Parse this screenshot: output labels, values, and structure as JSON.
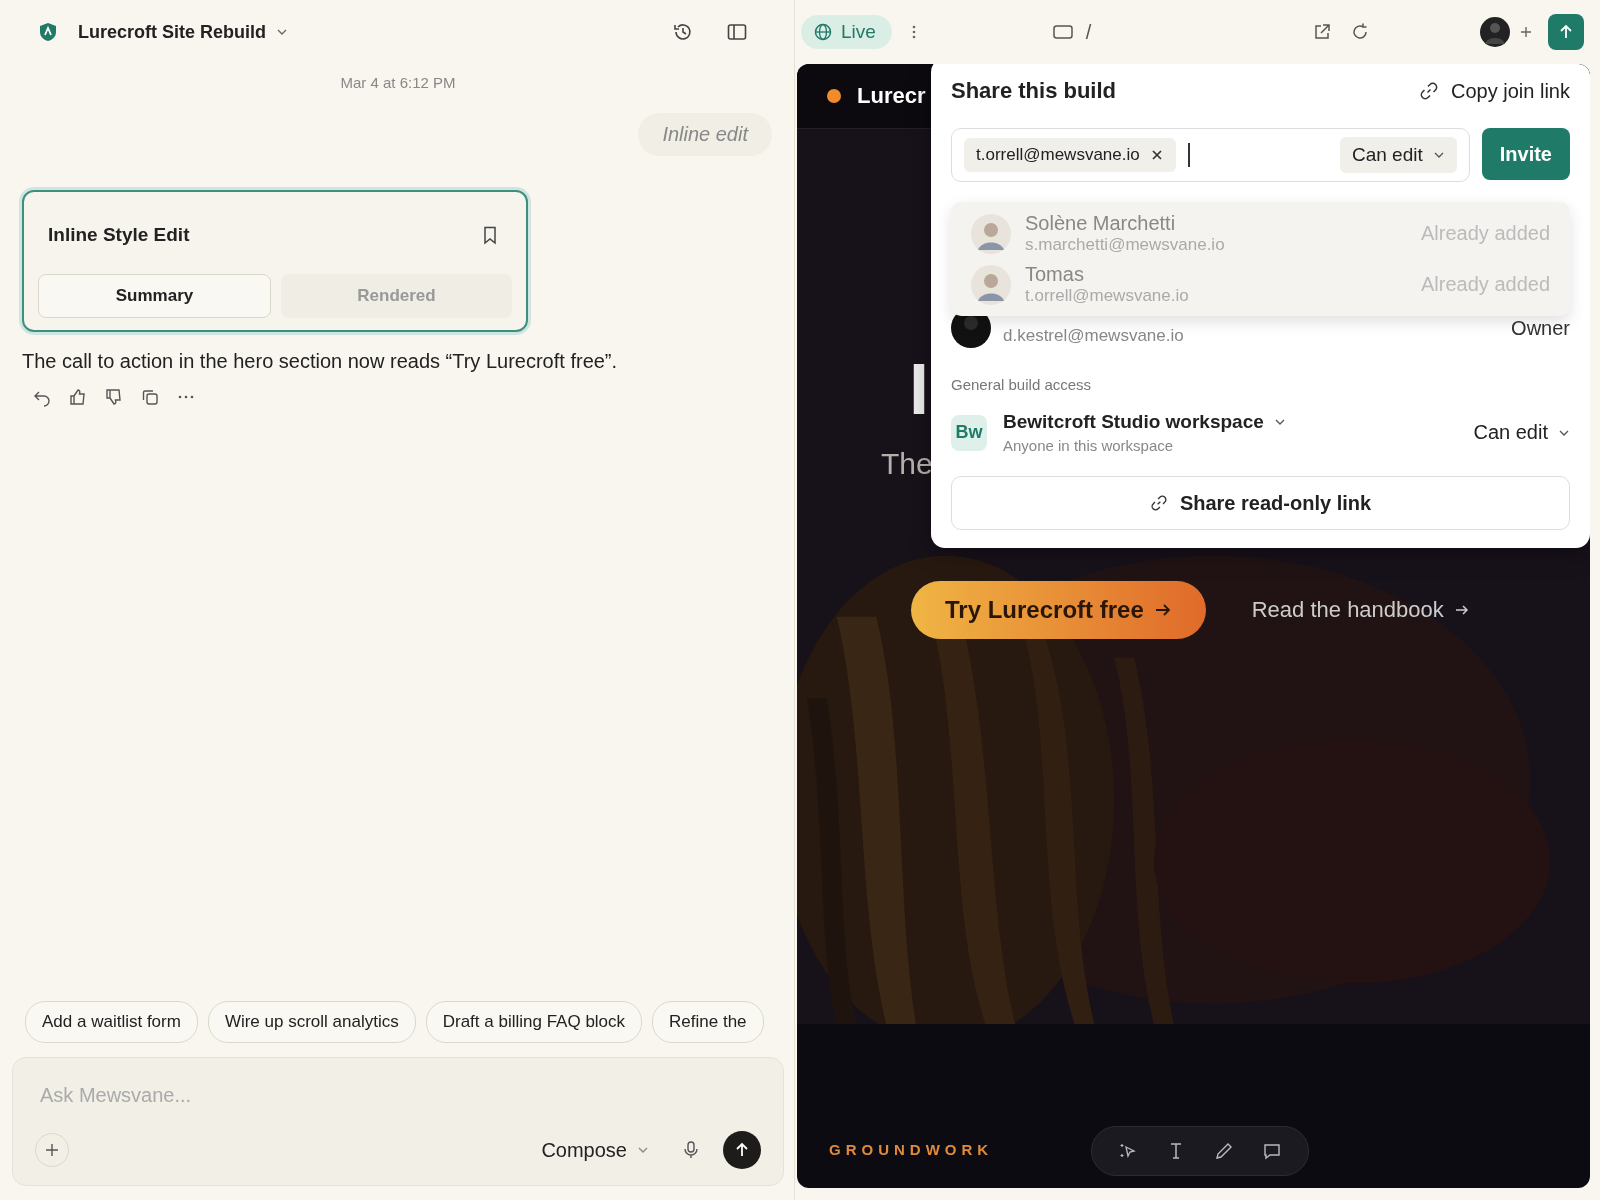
{
  "project": {
    "title": "Lurecroft Site Rebuild"
  },
  "chat": {
    "timestamp": "Mar 4 at 6:12 PM",
    "user_message": "Inline edit",
    "card": {
      "title": "Inline Style Edit",
      "tabs": [
        {
          "label": "Summary",
          "selected": true
        },
        {
          "label": "Rendered",
          "selected": false
        }
      ]
    },
    "reply": "The call to action in the hero section now reads “Try Lurecroft free”."
  },
  "suggestions": [
    "Add a waitlist form",
    "Wire up scroll analytics",
    "Draft a billing FAQ block",
    "Refine the"
  ],
  "composer": {
    "placeholder": "Ask Mewsvane...",
    "mode": "Compose"
  },
  "preview_toolbar": {
    "status": "Live",
    "path": "/"
  },
  "site": {
    "brand": "Lurecr",
    "headline": "I",
    "subtitle": "The",
    "cta": "Try Lurecroft free",
    "secondary_link": "Read the handbook",
    "section_label": "GROUNDWORK"
  },
  "share": {
    "title": "Share this build",
    "copy_link": "Copy join link",
    "invitee": "t.orrell@mewsvane.io",
    "permission": "Can edit",
    "invite_button": "Invite",
    "suggestions": [
      {
        "name": "Solène Marchetti",
        "email": "s.marchetti@mewsvane.io",
        "status": "Already added"
      },
      {
        "name": "Tomas",
        "email": "t.orrell@mewsvane.io",
        "status": "Already added"
      }
    ],
    "members": [
      {
        "email": "d.kestrel@mewsvane.io",
        "role": "Owner"
      }
    ],
    "general_access_label": "General build access",
    "workspace": {
      "initials": "Bw",
      "name": "Bewitcroft Studio workspace",
      "description": "Anyone in this workspace",
      "permission": "Can edit"
    },
    "readonly_link": "Share read-only link"
  }
}
